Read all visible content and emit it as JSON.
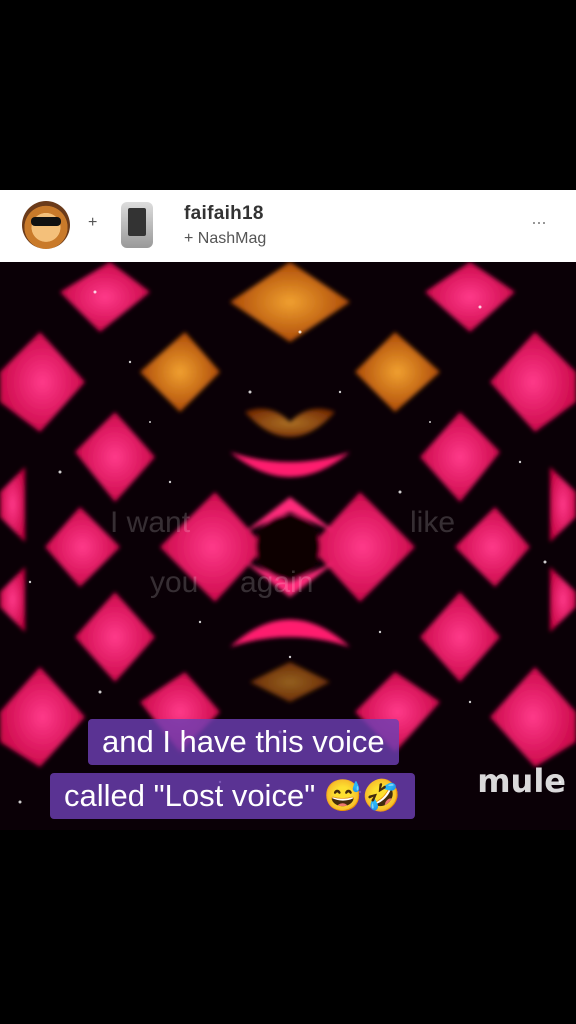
{
  "header": {
    "primary_user": "faifaih18",
    "secondary_user": "+ NashMag",
    "plus_sign": "+",
    "more_label": "···"
  },
  "video": {
    "background_words": [
      "I want",
      "like",
      "you",
      "again"
    ],
    "logo": "mule"
  },
  "caption": {
    "line1": "and I have this voice",
    "line2": "called \"Lost voice\" 😅🤣"
  },
  "colors": {
    "caption_bg": "#6c3eb2",
    "magenta": "#ff1a6e",
    "orange": "#e8891c"
  }
}
